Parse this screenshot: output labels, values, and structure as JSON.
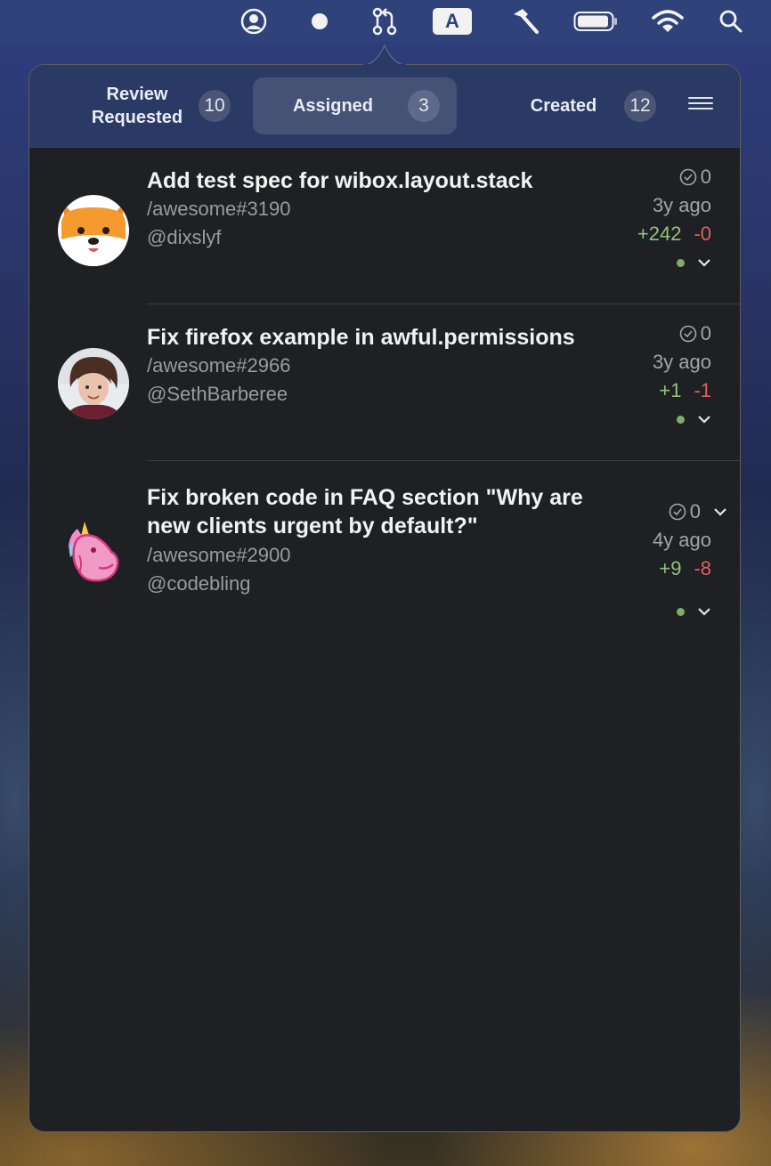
{
  "menubar": {
    "icons": [
      "user-circle-icon",
      "dot-icon",
      "pull-request-icon",
      "input-source-icon",
      "hammer-icon",
      "battery-icon",
      "wifi-icon",
      "search-icon"
    ],
    "input_source_label": "A"
  },
  "tabs": [
    {
      "label": "Review Requested",
      "count": "10",
      "active": false
    },
    {
      "label": "Assigned",
      "count": "3",
      "active": true
    },
    {
      "label": "Created",
      "count": "12",
      "active": false
    }
  ],
  "pull_requests": [
    {
      "title": "Add test spec for wibox.layout.stack",
      "repo": "/awesome#3190",
      "author": "@dixslyf",
      "checks": "0",
      "age": "3y ago",
      "additions": "+242",
      "deletions": "-0",
      "avatar": "shiba-avatar"
    },
    {
      "title": "Fix firefox example in awful.permissions",
      "repo": "/awesome#2966",
      "author": "@SethBarberee",
      "checks": "0",
      "age": "3y ago",
      "additions": "+1",
      "deletions": "-1",
      "avatar": "photo-avatar"
    },
    {
      "title": "Fix broken code in FAQ section \"Why are new clients urgent by default?\"",
      "repo": "/awesome#2900",
      "author": "@codebling",
      "checks": "0",
      "age": "4y ago",
      "additions": "+9",
      "deletions": "-8",
      "avatar": "unicorn-avatar"
    }
  ],
  "colors": {
    "menubar": "#2f4279",
    "popover_bg": "#1f2023",
    "tab_bar": "#2b3a65",
    "additions": "#92c27a",
    "deletions": "#e0605e"
  }
}
